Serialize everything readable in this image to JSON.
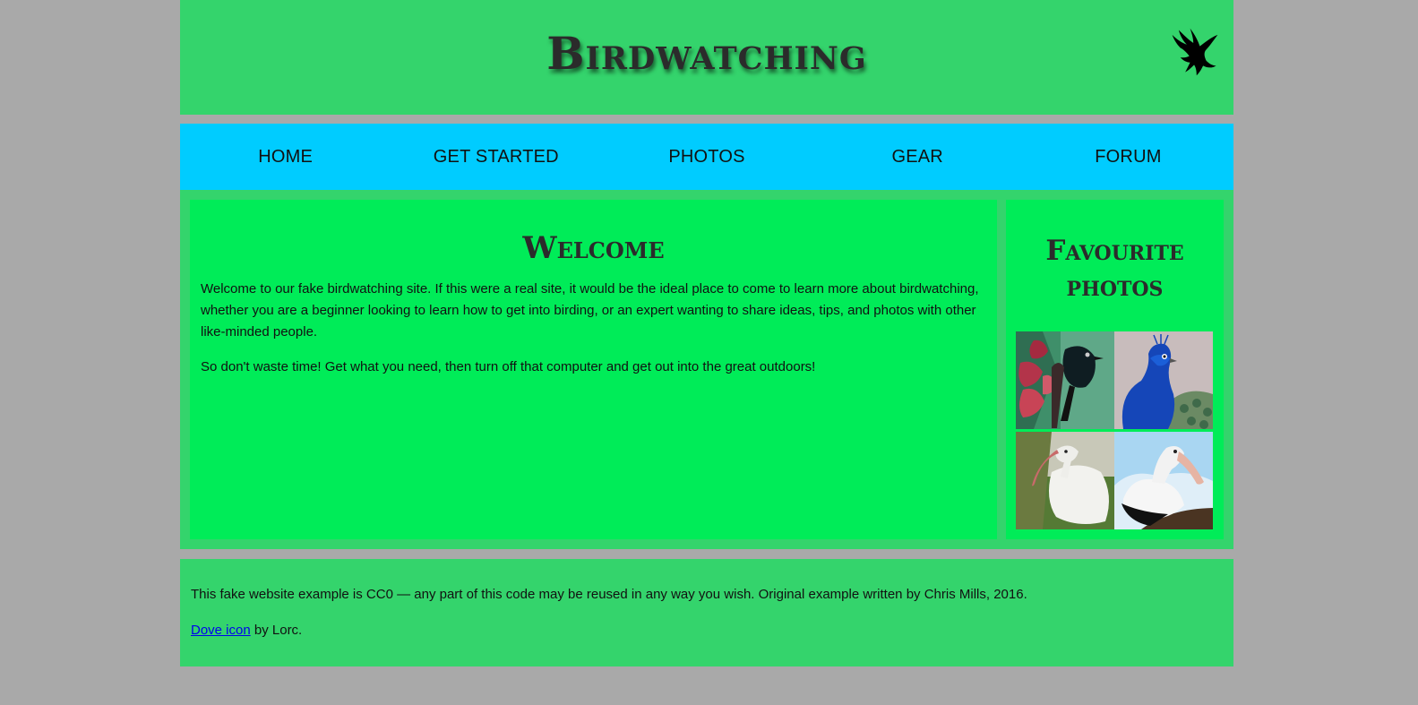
{
  "header": {
    "site_title": "Birdwatching",
    "logo_icon": "dove-icon"
  },
  "nav": {
    "items": [
      {
        "label": "HOME"
      },
      {
        "label": "GET STARTED"
      },
      {
        "label": "PHOTOS"
      },
      {
        "label": "GEAR"
      },
      {
        "label": "FORUM"
      }
    ]
  },
  "main": {
    "heading": "Welcome",
    "paragraphs": [
      "Welcome to our fake birdwatching site. If this were a real site, it would be the ideal place to come to learn more about birdwatching, whether you are a beginner looking to learn how to get into birding, or an expert wanting to share ideas, tips, and photos with other like-minded people.",
      "So don't waste time! Get what you need, then turn off that computer and get out into the great outdoors!"
    ]
  },
  "sidebar": {
    "heading": "Favourite photos",
    "photos": [
      {
        "name": "tui-on-flax-photo"
      },
      {
        "name": "peacock-photo"
      },
      {
        "name": "white-ibis-photo"
      },
      {
        "name": "pelican-photo"
      }
    ]
  },
  "footer": {
    "credit": "This fake website example is CC0 — any part of this code may be reused in any way you wish. Original example written by Chris Mills, 2016.",
    "dove_link": "Dove icon",
    "dove_suffix": " by Lorc."
  },
  "colors": {
    "page_background": "#a9a9a9",
    "header_footer_green": "#34d46c",
    "nav_blue": "#00ccff",
    "content_green": "#00ec58",
    "link_blue": "#0000ee"
  }
}
